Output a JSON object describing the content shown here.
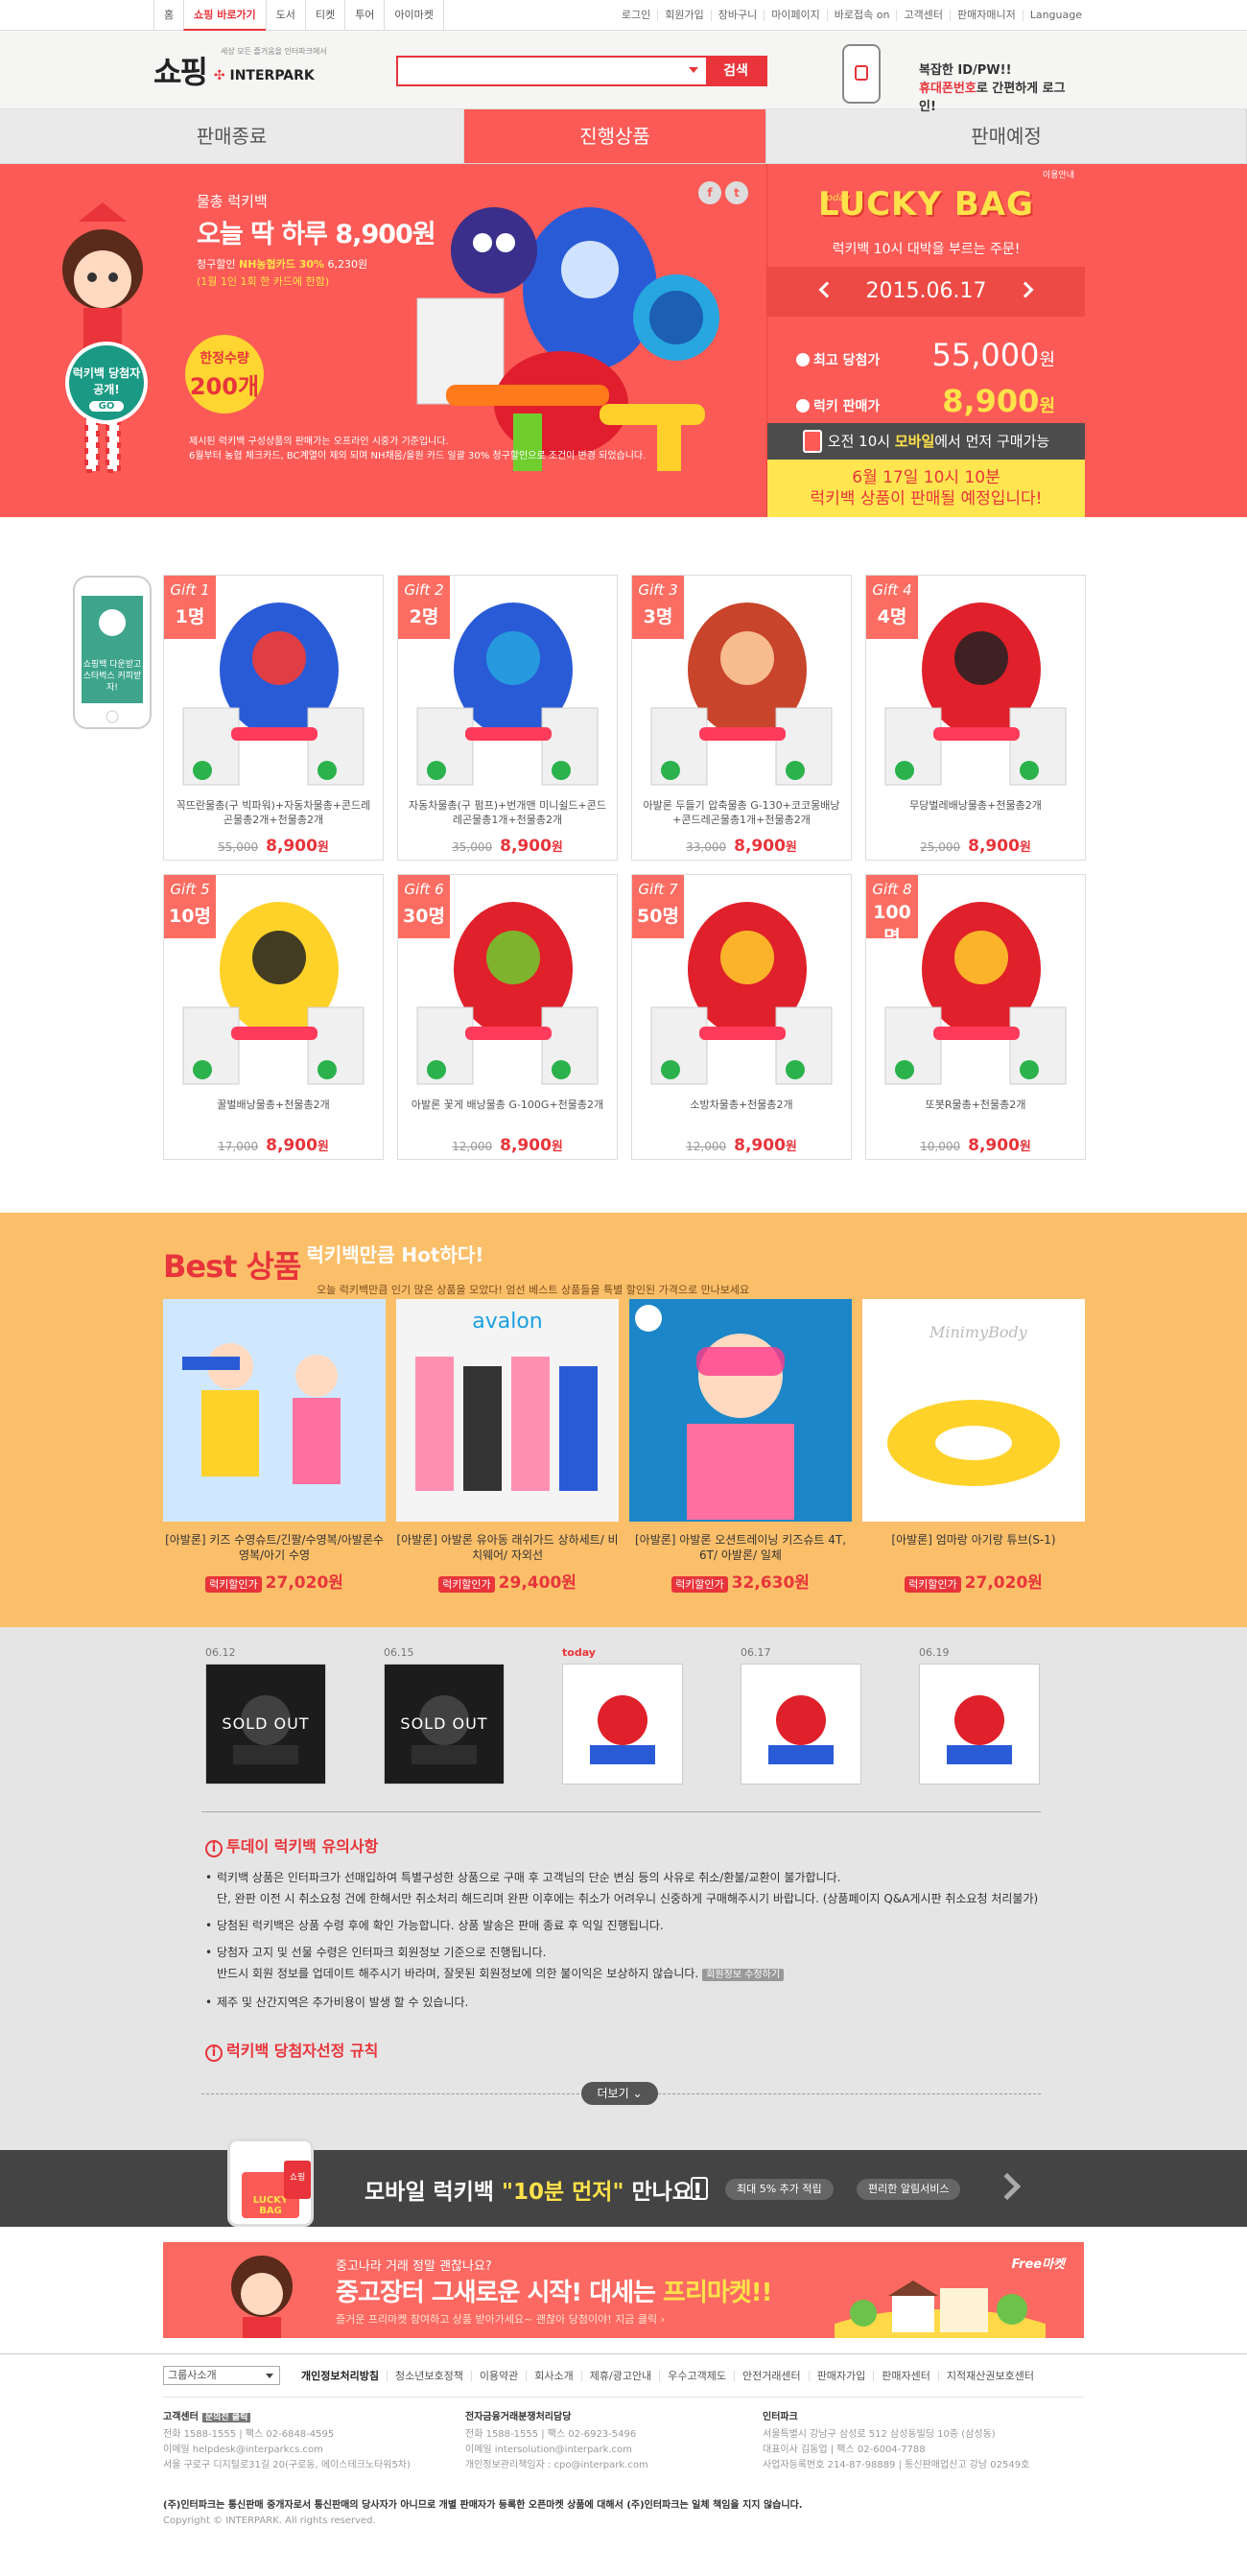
{
  "topbar": {
    "tabs": [
      "홈",
      "쇼핑 바로가기",
      "도서",
      "티켓",
      "투어",
      "아이마켓"
    ],
    "links": [
      "로그인",
      "회원가입",
      "장바구니",
      "마이페이지",
      "바로접속 on",
      "고객센터",
      "판매자매니저",
      "Language"
    ]
  },
  "header": {
    "logo_ko": "쇼핑",
    "logo_sub": "세상 모든 즐거움을 인터파크에서",
    "logo_brand": "INTERPARK",
    "search_value": "",
    "search_button": "검색",
    "phone_ad_line1": "복잡한 ID/PW!!",
    "phone_ad_hl": "휴대폰번호",
    "phone_ad_line2": "로 간편하게 로그인!"
  },
  "sale_tabs": [
    "판매종료",
    "진행상품",
    "판매예정"
  ],
  "hero": {
    "title1": "물총 럭키백",
    "title2": "오늘 딱 하루 8,900원",
    "discount_lead": "청구할인",
    "discount": "NH농협카드 30%",
    "discount_price": "6,230원",
    "discount_note": "(1월 1인 1회 한 카드에 한함)",
    "badge1": "럭키백 당첨자공개!",
    "badge1_btn": "GO",
    "badge2_lead": "한정수량",
    "badge2_val": "200개",
    "note1": "제시된 럭키백 구성상품의 판매가는 오프라인 시중가 기준입니다.",
    "note2": "6월부터 농협 체크카드, BC계열이 제외 되며 NH채움/올원 카드 일괄 30% 청구할인으로 조건이 변경 되었습니다.",
    "social": [
      "f",
      "t"
    ]
  },
  "lucky": {
    "usage": "이용안내",
    "today": "today",
    "logo": "LUCKY BAG",
    "sub": "럭키백 10시 대박을 부르는 주문!",
    "date": "2015.06.17",
    "row1_label": "최고 당첨가",
    "row1_value": "55,000",
    "row2_label": "럭키 판매가",
    "row2_value": "8,900",
    "won": "원",
    "mobile_text_a": "오전 10시",
    "mobile_text_b": "모바일",
    "mobile_text_c": "에서 먼저 구매가능",
    "notice1": "6월 17일 10시 10분",
    "notice2": "럭키백 상품이 판매될 예정입니다!"
  },
  "side_ad": "쇼핑백 다운받고 스타벅스 커피받자!",
  "gifts": [
    {
      "tag": "Gift 1",
      "count": "1명",
      "name": "꼭뜨란물총(구 빅파워)+자동차물총+콘드레곤물총2개+천물총2개",
      "orig": "55,000",
      "price": "8,900"
    },
    {
      "tag": "Gift 2",
      "count": "2명",
      "name": "자동차물총(구 펌프)+번개맨 미니쉴드+콘드레곤물총1개+천물총2개",
      "orig": "35,000",
      "price": "8,900"
    },
    {
      "tag": "Gift 3",
      "count": "3명",
      "name": "아발론 두들기 압축물총 G-130+코코몽배낭+콘드레곤물총1개+천물총2개",
      "orig": "33,000",
      "price": "8,900"
    },
    {
      "tag": "Gift 4",
      "count": "4명",
      "name": "무당벌레배낭물총+천물총2개",
      "orig": "25,000",
      "price": "8,900"
    },
    {
      "tag": "Gift 5",
      "count": "10명",
      "name": "꿀벌배낭물총+천물총2개",
      "orig": "17,000",
      "price": "8,900"
    },
    {
      "tag": "Gift 6",
      "count": "30명",
      "name": "아발론 꽃게 배낭물총 G-100G+천물총2개",
      "orig": "12,000",
      "price": "8,900"
    },
    {
      "tag": "Gift 7",
      "count": "50명",
      "name": "소방차물총+천물총2개",
      "orig": "12,000",
      "price": "8,900"
    },
    {
      "tag": "Gift 8",
      "count": "100명",
      "name": "또봇R물총+천물총2개",
      "orig": "10,000",
      "price": "8,900"
    }
  ],
  "best": {
    "title1": "Best 상품",
    "title2": "럭키백만큼 Hot하다!",
    "desc": "오늘 럭키백만큼 인기 많은 상품을 모았다! 엄선 베스트 상품들을 특별 할인된 가격으로 만나보세요",
    "price_label": "럭키할인가",
    "items": [
      {
        "name": "[아발론] 키즈 수영슈트/긴팔/수영복/아발론수영복/아기 수영",
        "price": "27,020원"
      },
      {
        "name": "[아발론] 아발론 유아동 래쉬가드 상하세트/ 비치웨어/ 자외선",
        "price": "29,400원"
      },
      {
        "name": "[아발론] 아발론 오션트레이닝 키즈슈트 4T, 6T/ 아발론/ 일체",
        "price": "32,630원"
      },
      {
        "name": "[아발론] 엄마랑 아기랑 튜브(S-1)",
        "price": "27,020원"
      }
    ],
    "item2_brand": "avalon",
    "item4_brand": "MinimyBody"
  },
  "history": [
    {
      "date": "06.12",
      "sold": "SOLD OUT"
    },
    {
      "date": "06.15",
      "sold": "SOLD OUT"
    },
    {
      "date": "today",
      "sold": ""
    },
    {
      "date": "06.17",
      "sold": ""
    },
    {
      "date": "06.19",
      "sold": ""
    }
  ],
  "notice": {
    "title": "투데이 럭키백 유의사항",
    "items": [
      "럭키백 상품은 인터파크가 선매입하여 특별구성한 상품으로 구매 후 고객님의 단순 변심 등의 사유로 취소/환불/교환이 불가합니다.",
      "단, 완판 이전 시 취소요청 건에 한해서만 취소처리 해드리며 완판 이후에는 취소가 어려우니 신중하게 구매해주시기 바랍니다. (상품페이지 Q&A게시판 취소요청 처리불가)",
      "당첨된 럭키백은 상품 수령 후에 확인 가능합니다. 상품 발송은 판매 종료 후 익일 진행됩니다.",
      "당첨자 고지 및 선물 수령은 인터파크 회원정보 기준으로 진행됩니다.",
      "반드시 회원 정보를 업데이트 해주시기 바라며, 잘못된 회원정보에 의한 불이익은 보상하지 않습니다.",
      "제주 및 산간지역은 추가비용이 발생 할 수 있습니다."
    ],
    "chip": "회원정보 수정하기",
    "rule_title": "럭키백 당첨자선정 규칙",
    "more": "더보기"
  },
  "mobile_banner": {
    "lead": "모바일 럭키백",
    "hl": "\"10분 먼저\"",
    "tail": "만나요!",
    "pill1": "최대 5% 추가 적립",
    "pill2": "편리한 알림서비스",
    "phone_bag": "LUCKY BAG",
    "phone_shop": "쇼핑"
  },
  "freemarket": {
    "q1": "중고나라 거래 정말 괜찮나요?",
    "q2a": "중고장터 그새로운 시작! 대세는 ",
    "q2b": "프리마켓!!",
    "q3": "즐거운 프리마켓 참여하고 상품 받아가세요~ 괜찮아 당첨이야! 지금 클릭 ›",
    "tag": "Free마켓"
  },
  "footer": {
    "select": "그룹사소개",
    "nav": [
      "개인정보처리방침",
      "청소년보호정책",
      "이용약관",
      "회사소개",
      "제휴/광고안내",
      "우수고객제도",
      "안전거래센터",
      "판매자가입",
      "판매자센터",
      "지적재산권보호센터"
    ],
    "col1_title": "고객센터",
    "col1_chip": "문의전 클릭",
    "col1": [
      "전화 1588-1555 | 팩스 02-6848-4595",
      "이메일 helpdesk@interparkcs.com",
      "서울 구로구 디지털로31길 20(구로동, 에이스테크노타워5차)"
    ],
    "col2_title": "전자금융거래분쟁처리담당",
    "col2": [
      "전화 1588-1555 | 팩스 02-6923-5496",
      "이메일 intersolution@interpark.com",
      "개인정보관리책임자 : cpo@interpark.com"
    ],
    "col3_title": "인터파크",
    "col3": [
      "서울특별시 강남구 삼성로 512 삼성동빌딩 10층 (삼성동)",
      "대표이사 김동업 | 팩스 02-6004-7788",
      "사업자등록번호 214-87-98889 | 통신판매업신고 강남 02549호"
    ],
    "disclaimer": "(주)인터파크는 통신판매 중개자로서 통신판매의 당사자가 아니므로 개별 판매자가 등록한 오픈마켓 상품에 대해서 (주)인터파크는 일체 책임을 지지 않습니다.",
    "copyright": "Copyright © INTERPARK. All rights reserved."
  }
}
